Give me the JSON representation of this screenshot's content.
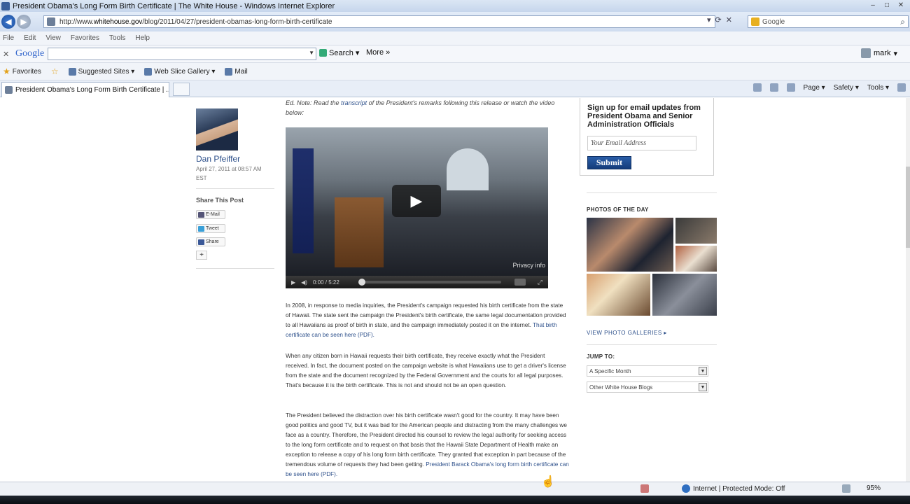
{
  "window": {
    "title": "President Obama's Long Form Birth Certificate | The White House - Windows Internet Explorer",
    "controls": [
      "–",
      "□",
      "✕"
    ]
  },
  "address_bar": {
    "url_prefix": "http://www.",
    "url_host": "whitehouse.gov",
    "url_path": "/blog/2011/04/27/president-obamas-long-form-birth-certificate",
    "search_placeholder": "Google"
  },
  "menu": [
    "File",
    "Edit",
    "View",
    "Favorites",
    "Tools",
    "Help"
  ],
  "google_toolbar": {
    "logo": "Google",
    "search_label": "Search",
    "more_label": "More »",
    "user": "mark"
  },
  "favorites_bar": {
    "favorites_label": "Favorites",
    "items": [
      "Suggested Sites ▾",
      "Web Slice Gallery ▾",
      "Mail"
    ]
  },
  "tabs": {
    "active_title": "President Obama's Long Form Birth Certificate | ..."
  },
  "command_bar": {
    "page_label": "Page ▾",
    "safety_label": "Safety ▾",
    "tools_label": "Tools ▾"
  },
  "author": {
    "name": "Dan Pfeiffer",
    "date": "April 27, 2011 at 08:57 AM EST"
  },
  "share": {
    "heading": "Share This Post",
    "email": "E-Mail",
    "tweet": "Tweet",
    "share": "Share",
    "plus": "+"
  },
  "ed_note": {
    "prefix": "Ed. Note: Read the ",
    "link": "transcript",
    "suffix": " of the President's remarks following this release or watch the video below:"
  },
  "video": {
    "time": "0:00 / 5:22",
    "privacy": "Privacy info"
  },
  "paragraphs": [
    {
      "text": "In 2008, in response to media inquiries, the President's campaign requested his birth certificate from the state of Hawaii. The state sent the campaign the President's birth certificate, the same legal documentation provided to all Hawaiians as proof of birth in state, and the campaign immediately posted it on the internet. ",
      "link": "That birth certificate can be seen here (PDF)."
    },
    {
      "text": "When any citizen born in Hawaii requests their birth certificate, they receive exactly what the President received. In fact, the document posted on the campaign website is what Hawaiians use to get a driver's license from the state and the document recognized by the Federal Government and the courts for all legal purposes. That's because it is the birth certificate. This is not and should not be an open question.",
      "link": ""
    },
    {
      "text": "The President believed the distraction over his birth certificate wasn't good for the country. It may have been good politics and good TV, but it was bad for the American people and distracting from the many challenges we face as a country. Therefore, the President directed his counsel to review the legal authority for seeking access to the long form certificate and to request on that basis that the Hawaii State Department of Health make an exception to release a copy of his long form birth certificate. They granted that exception in part because of the tremendous volume of requests they had been getting. ",
      "link": "President Barack Obama's long form birth certificate can be seen here (PDF)."
    }
  ],
  "signup": {
    "heading": "Sign up for email updates from President Obama and Senior Administration Officials",
    "email_placeholder": "Your Email Address",
    "submit": "Submit"
  },
  "photos": {
    "heading": "PHOTOS OF THE DAY",
    "gallery_link": "VIEW PHOTO GALLERIES ▸"
  },
  "jump_to": {
    "heading": "JUMP TO:",
    "month": "A Specific Month",
    "blogs": "Other White House Blogs"
  },
  "status_bar": {
    "zone": "Internet | Protected Mode: Off",
    "zoom": "95%"
  }
}
